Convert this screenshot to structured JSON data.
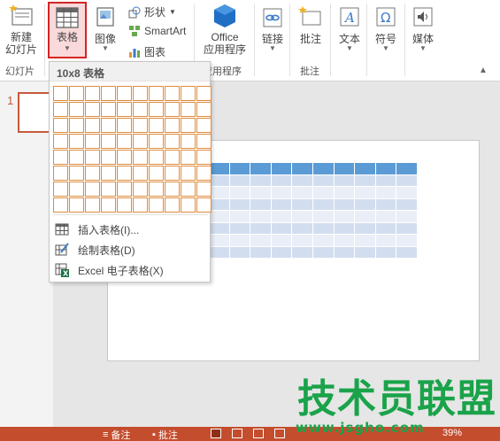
{
  "ribbon": {
    "new_slide": {
      "label_line1": "新建",
      "label_line2": "幻灯片"
    },
    "group_slides": "幻灯片",
    "table": {
      "label": "表格"
    },
    "image": {
      "label": "图像"
    },
    "shapes": {
      "label": "形状"
    },
    "smartart": {
      "label": "SmartArt"
    },
    "chart": {
      "label": "图表"
    },
    "office_apps": {
      "label_line1": "Office",
      "label_line2": "应用程序"
    },
    "group_apps": "应用程序",
    "link": {
      "label": "链接"
    },
    "comment": {
      "label": "批注"
    },
    "group_comment": "批注",
    "text": {
      "label": "文本"
    },
    "symbol": {
      "label": "符号"
    },
    "media": {
      "label": "媒体"
    }
  },
  "dropdown": {
    "header": "10x8 表格",
    "grid": {
      "columns": 10,
      "rows": 8
    },
    "items": [
      {
        "label": "插入表格(I)...",
        "icon": "insert-table-icon"
      },
      {
        "label": "绘制表格(D)",
        "icon": "draw-table-icon"
      },
      {
        "label": "Excel 电子表格(X)",
        "icon": "excel-icon"
      }
    ]
  },
  "slides": {
    "thumbnail_number": "1"
  },
  "preview_table": {
    "columns": 10,
    "rows": 8
  },
  "statusbar": {
    "notes": "备注",
    "comments": "批注",
    "zoom": "39%"
  },
  "watermark": {
    "title": "技术员联盟",
    "url": "www.jsgho.com"
  },
  "colors": {
    "accent": "#c44d2e",
    "table_highlight": "#e08c3c",
    "preview_header": "#5b9bd5",
    "watermark": "#1aa34a"
  }
}
